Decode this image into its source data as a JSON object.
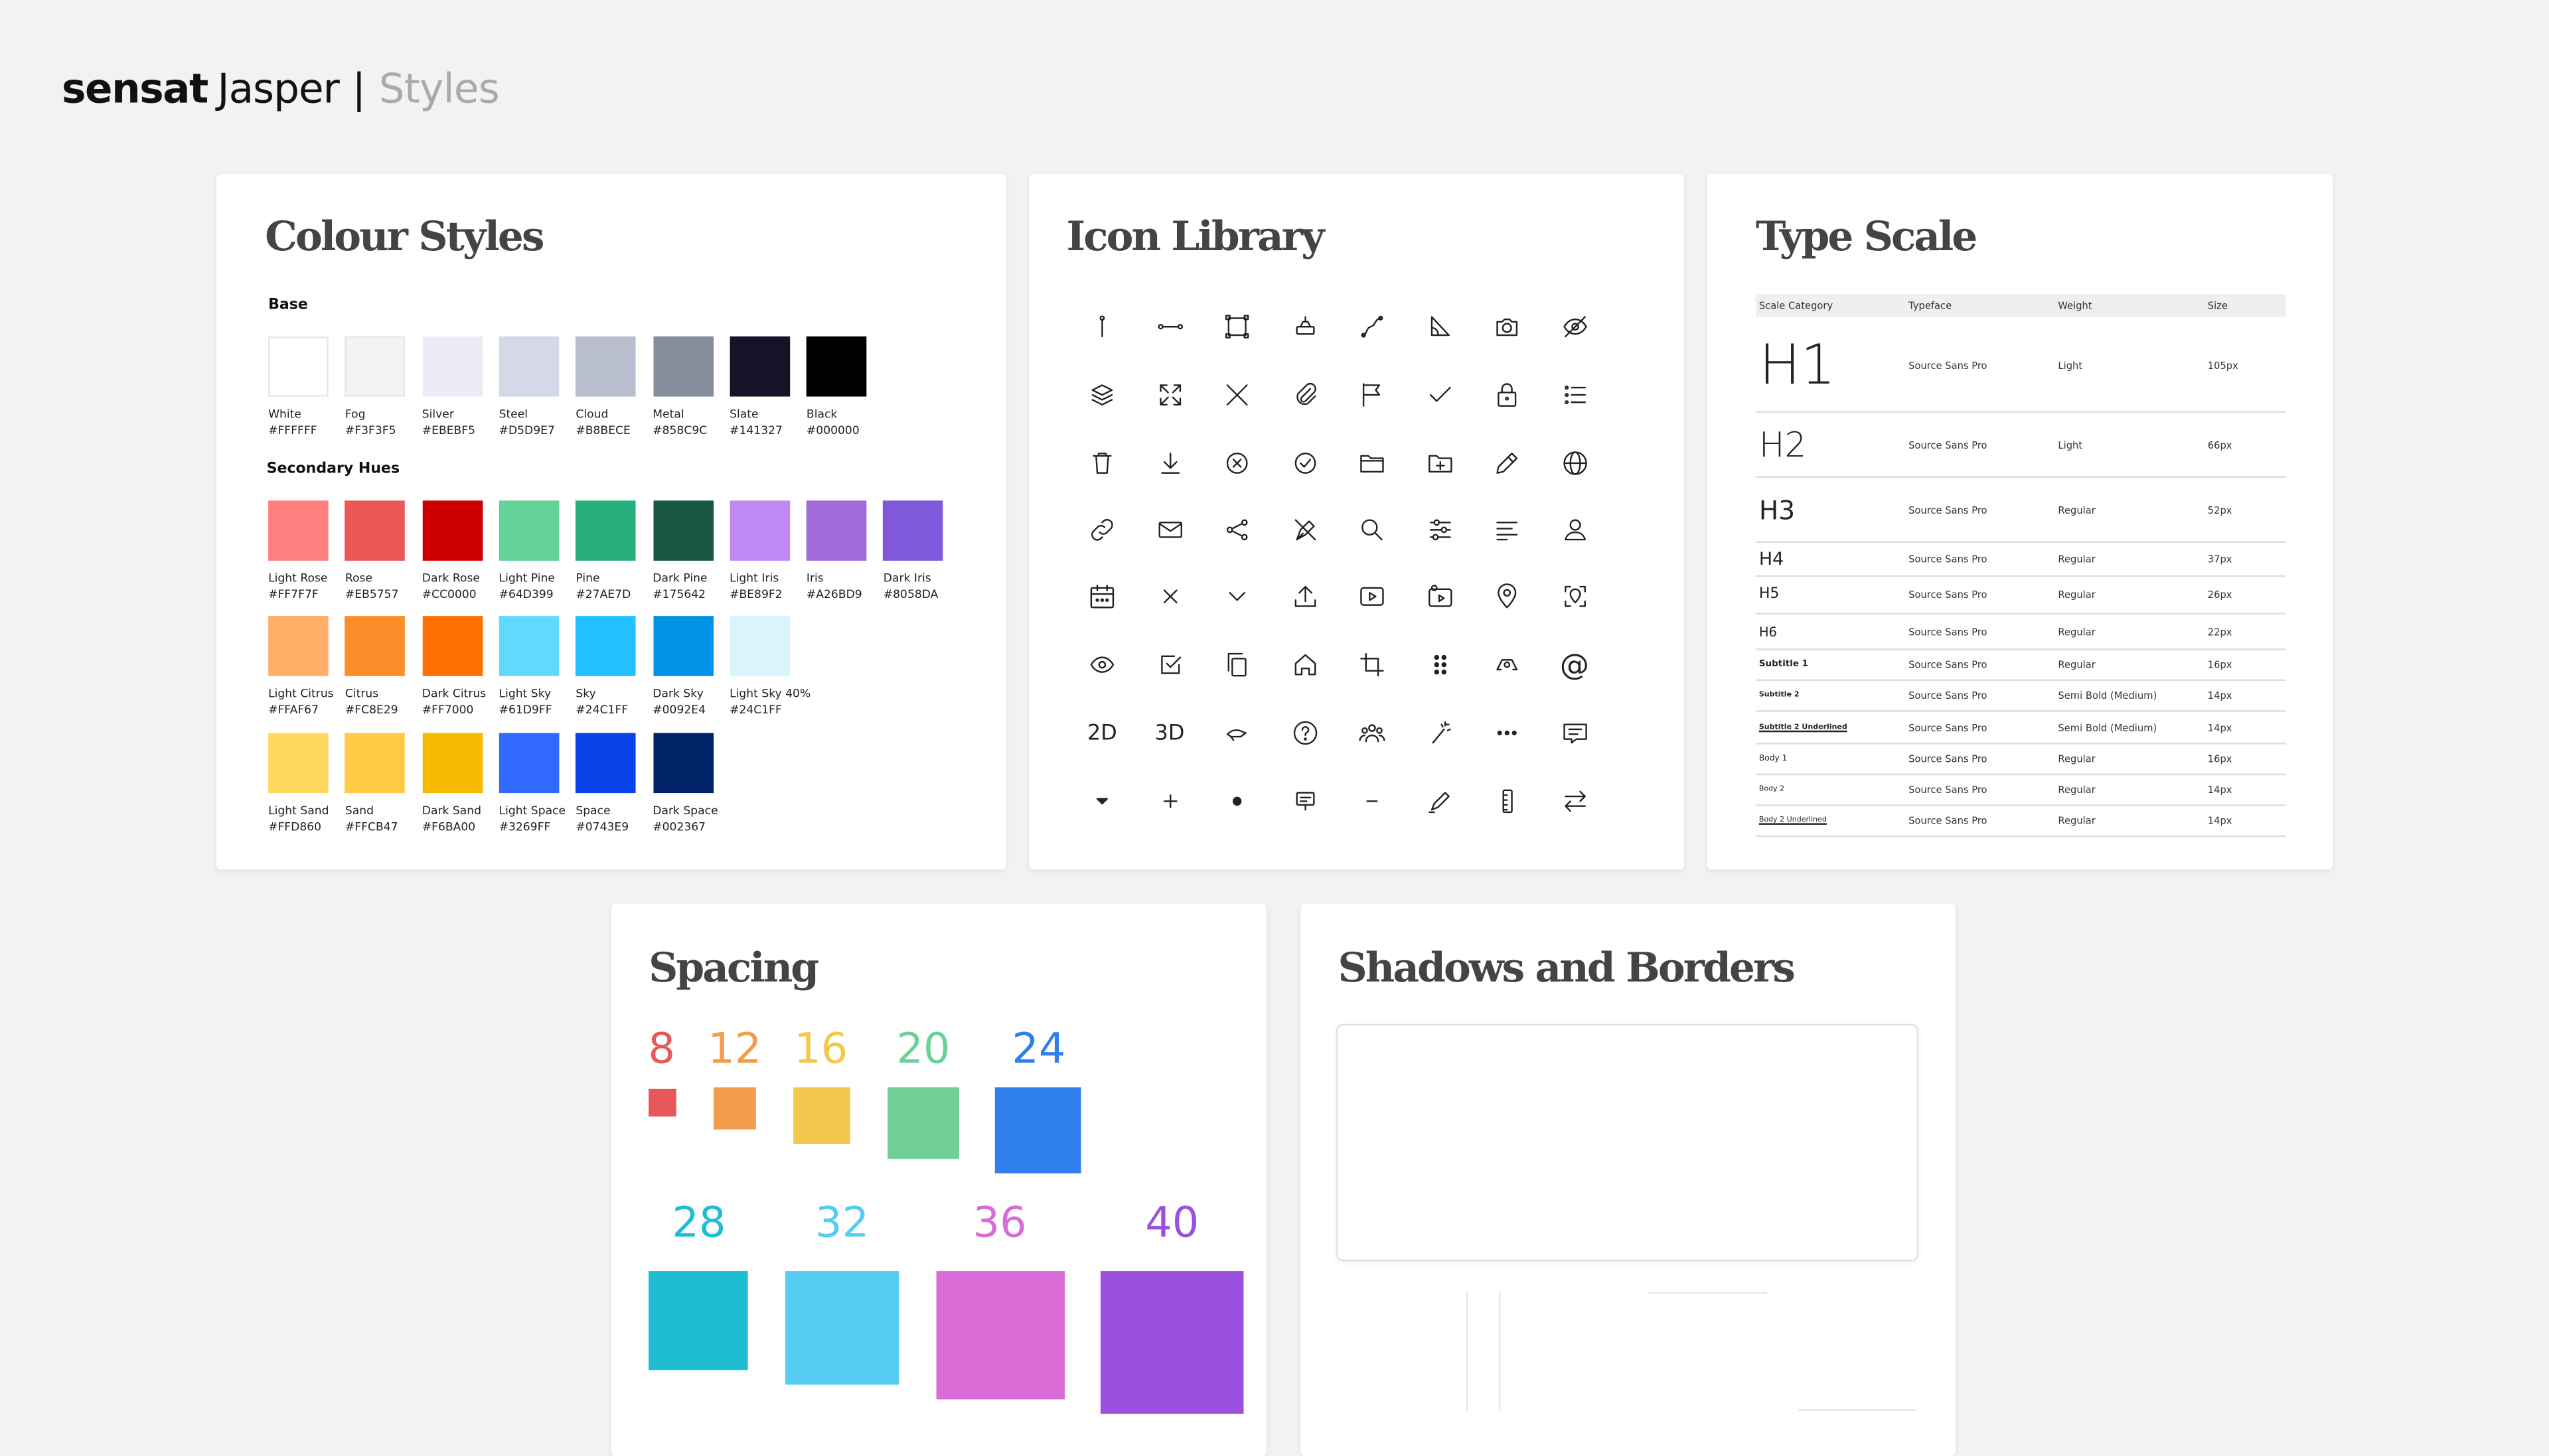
{
  "header": {
    "brand": "sensat",
    "product": "Jasper",
    "separator": "|",
    "section": "Styles"
  },
  "colour_styles": {
    "title": "Colour Styles",
    "base_heading": "Base",
    "base": [
      {
        "name": "White",
        "hex": "#FFFFFF"
      },
      {
        "name": "Fog",
        "hex": "#F3F3F5"
      },
      {
        "name": "Silver",
        "hex": "#EBEBF5"
      },
      {
        "name": "Steel",
        "hex": "#D5D9E7"
      },
      {
        "name": "Cloud",
        "hex": "#B8BECE"
      },
      {
        "name": "Metal",
        "hex": "#858C9C"
      },
      {
        "name": "Slate",
        "hex": "#141327"
      },
      {
        "name": "Black",
        "hex": "#000000"
      }
    ],
    "secondary_heading": "Secondary Hues",
    "secondary_rows": [
      [
        {
          "name": "Light Rose",
          "hex": "#FF7F7F"
        },
        {
          "name": "Rose",
          "hex": "#EB5757"
        },
        {
          "name": "Dark Rose",
          "hex": "#CC0000"
        },
        {
          "name": "Light Pine",
          "hex": "#64D399"
        },
        {
          "name": "Pine",
          "hex": "#27AE7D"
        },
        {
          "name": "Dark Pine",
          "hex": "#175642"
        },
        {
          "name": "Light Iris",
          "hex": "#BE89F2"
        },
        {
          "name": "Iris",
          "hex": "#A26BD9"
        },
        {
          "name": "Dark Iris",
          "hex": "#8058DA"
        }
      ],
      [
        {
          "name": "Light Citrus",
          "hex": "#FFAF67"
        },
        {
          "name": "Citrus",
          "hex": "#FC8E29"
        },
        {
          "name": "Dark Citrus",
          "hex": "#FF7000"
        },
        {
          "name": "Light Sky",
          "hex": "#61D9FF"
        },
        {
          "name": "Sky",
          "hex": "#24C1FF"
        },
        {
          "name": "Dark Sky",
          "hex": "#0092E4"
        },
        {
          "name": "Light Sky 40%",
          "hex": "#24C1FF",
          "swatch": "#D9F4FD"
        }
      ],
      [
        {
          "name": "Light Sand",
          "hex": "#FFD860"
        },
        {
          "name": "Sand",
          "hex": "#FFCB47"
        },
        {
          "name": "Dark Sand",
          "hex": "#F6BA00"
        },
        {
          "name": "Light Space",
          "hex": "#3269FF"
        },
        {
          "name": "Space",
          "hex": "#0743E9"
        },
        {
          "name": "Dark Space",
          "hex": "#002367"
        }
      ]
    ]
  },
  "icon_library": {
    "title": "Icon Library",
    "rows": [
      [
        "pin-icon",
        "line-segment-icon",
        "bounding-box-icon",
        "excavator-icon",
        "path-curve-icon",
        "angle-measure-icon",
        "camera-icon",
        "eye-off-icon"
      ],
      [
        "layers-icon",
        "expand-icon",
        "close-icon",
        "paperclip-icon",
        "flag-icon",
        "check-icon",
        "lock-icon",
        "list-icon"
      ],
      [
        "trash-icon",
        "download-icon",
        "close-circle-icon",
        "check-circle-icon",
        "folder-icon",
        "folder-add-icon",
        "pencil-icon",
        "globe-icon"
      ],
      [
        "link-icon",
        "mail-icon",
        "share-icon",
        "pen-nib-icon",
        "search-icon",
        "sliders-icon",
        "align-left-icon",
        "user-icon"
      ],
      [
        "calendar-icon",
        "x-icon",
        "chevron-down-icon",
        "upload-icon",
        "play-icon",
        "media-icon",
        "location-icon",
        "location-focus-icon"
      ],
      [
        "eye-icon",
        "checkbox-icon",
        "copy-icon",
        "home-icon",
        "crop-icon",
        "drag-handle-icon",
        "people-shield-icon",
        "at-icon"
      ],
      [
        "2d-icon",
        "3d-icon",
        "hand-icon",
        "help-icon",
        "group-icon",
        "magic-wand-icon",
        "more-icon",
        "comment-icon"
      ],
      [
        "caret-down-icon",
        "plus-icon",
        "dot-icon",
        "note-icon",
        "minus-icon",
        "edit-line-icon",
        "ruler-icon",
        "swap-icon"
      ]
    ],
    "text_icons": {
      "2d": "2D",
      "3d": "3D",
      "at": "@"
    }
  },
  "type_scale": {
    "title": "Type Scale",
    "headers": [
      "Scale Category",
      "Typeface",
      "Weight",
      "Size"
    ],
    "rows": [
      {
        "name": "H1",
        "typeface": "Source Sans Pro",
        "weight": "Light",
        "size": "105px"
      },
      {
        "name": "H2",
        "typeface": "Source Sans Pro",
        "weight": "Light",
        "size": "66px"
      },
      {
        "name": "H3",
        "typeface": "Source Sans Pro",
        "weight": "Regular",
        "size": "52px"
      },
      {
        "name": "H4",
        "typeface": "Source Sans Pro",
        "weight": "Regular",
        "size": "37px"
      },
      {
        "name": "H5",
        "typeface": "Source Sans Pro",
        "weight": "Regular",
        "size": "26px"
      },
      {
        "name": "H6",
        "typeface": "Source Sans Pro",
        "weight": "Regular",
        "size": "22px"
      },
      {
        "name": "Subtitle 1",
        "typeface": "Source Sans Pro",
        "weight": "Regular",
        "size": "16px"
      },
      {
        "name": "Subtitle 2",
        "typeface": "Source Sans Pro",
        "weight": "Semi Bold (Medium)",
        "size": "14px"
      },
      {
        "name": "Subtitle 2 Underlined",
        "typeface": "Source Sans Pro",
        "weight": "Semi Bold (Medium)",
        "size": "14px"
      },
      {
        "name": "Body 1",
        "typeface": "Source Sans Pro",
        "weight": "Regular",
        "size": "16px"
      },
      {
        "name": "Body 2",
        "typeface": "Source Sans Pro",
        "weight": "Regular",
        "size": "14px"
      },
      {
        "name": "Body 2 Underlined",
        "typeface": "Source Sans Pro",
        "weight": "Regular",
        "size": "14px"
      }
    ]
  },
  "spacing": {
    "title": "Spacing",
    "items": [
      {
        "value": "8",
        "color": "#E8585A"
      },
      {
        "value": "12",
        "color": "#F39C4A"
      },
      {
        "value": "16",
        "color": "#F2C94C"
      },
      {
        "value": "20",
        "color": "#6FCF97"
      },
      {
        "value": "24",
        "color": "#2F80ED"
      },
      {
        "value": "28",
        "color": "#1EBDD2"
      },
      {
        "value": "32",
        "color": "#56CCF2"
      },
      {
        "value": "36",
        "color": "#D96BD6"
      },
      {
        "value": "40",
        "color": "#9B51E0"
      }
    ]
  },
  "shadows_borders": {
    "title": "Shadows and Borders"
  }
}
